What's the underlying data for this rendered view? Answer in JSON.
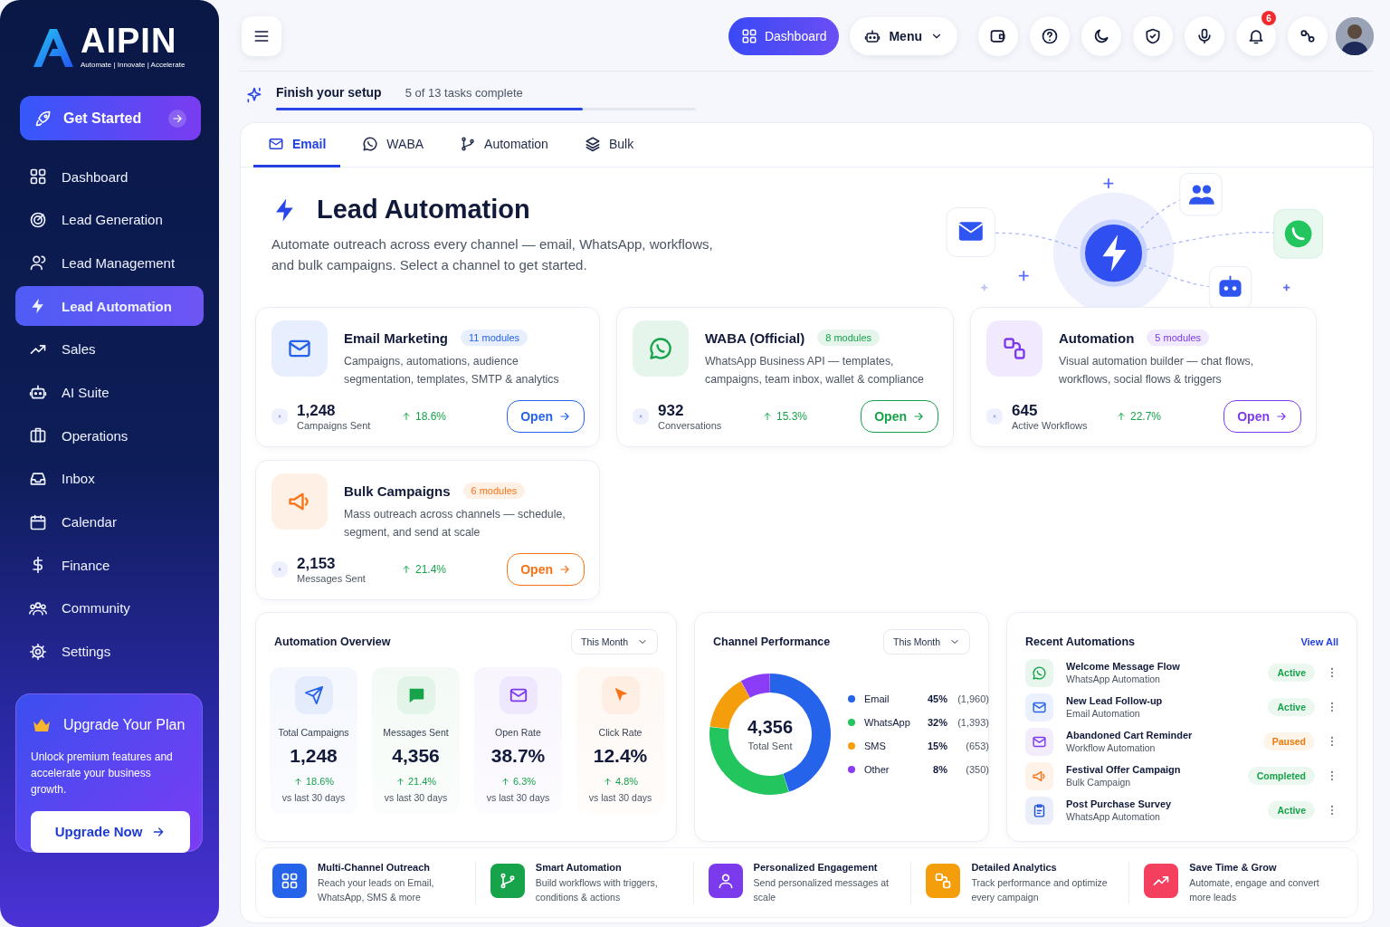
{
  "brand": {
    "name": "AIPIN",
    "tagline": "Automate | Innovate | Accelerate"
  },
  "get_started": "Get Started",
  "nav": [
    {
      "label": "Dashboard",
      "selected": false
    },
    {
      "label": "Lead Generation",
      "selected": false
    },
    {
      "label": "Lead Management",
      "selected": false
    },
    {
      "label": "Lead Automation",
      "selected": true
    },
    {
      "label": "Sales",
      "selected": false
    },
    {
      "label": "AI Suite",
      "selected": false
    },
    {
      "label": "Operations",
      "selected": false
    },
    {
      "label": "Inbox",
      "selected": false
    },
    {
      "label": "Calendar",
      "selected": false
    },
    {
      "label": "Finance",
      "selected": false
    },
    {
      "label": "Community",
      "selected": false
    },
    {
      "label": "Settings",
      "selected": false
    }
  ],
  "upgrade": {
    "title": "Upgrade Your Plan",
    "text": "Unlock premium features and accelerate your business growth.",
    "button": "Upgrade Now"
  },
  "topbar": {
    "dashboard": "Dashboard",
    "menu": "Menu",
    "notifications": "6"
  },
  "setup": {
    "title": "Finish your setup",
    "progress_text": "5 of 13 tasks complete",
    "level": 0.73
  },
  "tabs": [
    {
      "label": "Email",
      "selected": true
    },
    {
      "label": "WABA",
      "selected": false
    },
    {
      "label": "Automation",
      "selected": false
    },
    {
      "label": "Bulk",
      "selected": false
    }
  ],
  "hero": {
    "title": "Lead Automation",
    "description": "Automate outreach across every channel — email, WhatsApp, workflows, and bulk campaigns. Select a channel to get started."
  },
  "modules": [
    {
      "kind": "email",
      "title": "Email Marketing",
      "badge": "11 modules",
      "color": "#2563eb",
      "description": "Campaigns, automations, audience segmentation, templates, SMTP & analytics",
      "value": "1,248",
      "value_label": "Campaigns Sent",
      "delta": "18.6%",
      "button": "Open"
    },
    {
      "kind": "whatsapp",
      "title": "WABA (Official)",
      "badge": "8 modules",
      "color": "#16a34a",
      "description": "WhatsApp Business API — templates, campaigns, team inbox, wallet & compliance",
      "value": "932",
      "value_label": "Conversations",
      "delta": "15.3%",
      "button": "Open"
    },
    {
      "kind": "automation",
      "title": "Automation",
      "badge": "5 modules",
      "color": "#7c3aed",
      "description": "Visual automation builder — chat flows, workflows, social flows & triggers",
      "value": "645",
      "value_label": "Active Workflows",
      "delta": "22.7%",
      "button": "Open"
    },
    {
      "kind": "bulk",
      "title": "Bulk Campaigns",
      "badge": "6 modules",
      "color": "#f97316",
      "description": "Mass outreach across channels — schedule, segment, and send at scale",
      "value": "2,153",
      "value_label": "Messages Sent",
      "delta": "21.4%",
      "button": "Open"
    }
  ],
  "overview": {
    "title": "Automation Overview",
    "filter": "This Month",
    "stats": [
      {
        "kind": "send",
        "label": "Total Campaigns",
        "value": "1,248",
        "delta": "18.6%",
        "note": "vs last 30 days",
        "color": "#2563eb"
      },
      {
        "kind": "message",
        "label": "Messages Sent",
        "value": "4,356",
        "delta": "21.4%",
        "note": "vs last 30 days",
        "color": "#16a34a"
      },
      {
        "kind": "mail",
        "label": "Open Rate",
        "value": "38.7%",
        "delta": "6.3%",
        "note": "vs last 30 days",
        "color": "#7c3aed"
      },
      {
        "kind": "cursor",
        "label": "Click Rate",
        "value": "12.4%",
        "delta": "4.8%",
        "note": "vs last 30 days",
        "color": "#f97316"
      }
    ]
  },
  "channels": {
    "title": "Channel Performance",
    "filter": "This Month",
    "total": "4,356",
    "total_label": "Total Sent",
    "chart_data": {
      "type": "donut",
      "categories": [
        "Email",
        "WhatsApp",
        "SMS",
        "Other"
      ],
      "values": [
        45,
        32,
        15,
        8
      ]
    },
    "legend": [
      {
        "percent": "45%",
        "count": "(1,960)",
        "color": "#2563eb"
      },
      {
        "percent": "32%",
        "count": "(1,393)",
        "color": "#22c55e"
      },
      {
        "percent": "15%",
        "count": "(653)",
        "color": "#f59e0b"
      },
      {
        "percent": "8%",
        "count": "(350)",
        "color": "#8b3cf7"
      }
    ]
  },
  "recent": {
    "title": "Recent Automations",
    "link": "View All",
    "items": [
      {
        "kind": "whatsapp",
        "name": "Welcome Message Flow",
        "type": "WhatsApp Automation",
        "status": "Active",
        "color": "#16a34a"
      },
      {
        "kind": "email",
        "name": "New Lead Follow-up",
        "type": "Email Automation",
        "status": "Active",
        "color": "#16a34a"
      },
      {
        "kind": "workflow",
        "name": "Abandoned Cart Reminder",
        "type": "Workflow Automation",
        "status": "Paused",
        "color": "#ea7a0c"
      },
      {
        "kind": "bulk",
        "name": "Festival Offer Campaign",
        "type": "Bulk Campaign",
        "status": "Completed",
        "color": "#16a34a"
      },
      {
        "kind": "survey",
        "name": "Post Purchase Survey",
        "type": "WhatsApp Automation",
        "status": "Active",
        "color": "#16a34a"
      }
    ]
  },
  "features": [
    {
      "title": "Multi-Channel Outreach",
      "description": "Reach your leads on Email, WhatsApp, SMS & more",
      "color": "#2563eb"
    },
    {
      "title": "Smart Automation",
      "description": "Build workflows with triggers, conditions & actions",
      "color": "#16a34a"
    },
    {
      "title": "Personalized Engagement",
      "description": "Send personalized messages at scale",
      "color": "#7c3aed"
    },
    {
      "title": "Detailed Analytics",
      "description": "Track performance and optimize every campaign",
      "color": "#f59e0b"
    },
    {
      "title": "Save Time & Grow",
      "description": "Automate, engage and convert more leads",
      "color": "#f43f5e"
    }
  ]
}
